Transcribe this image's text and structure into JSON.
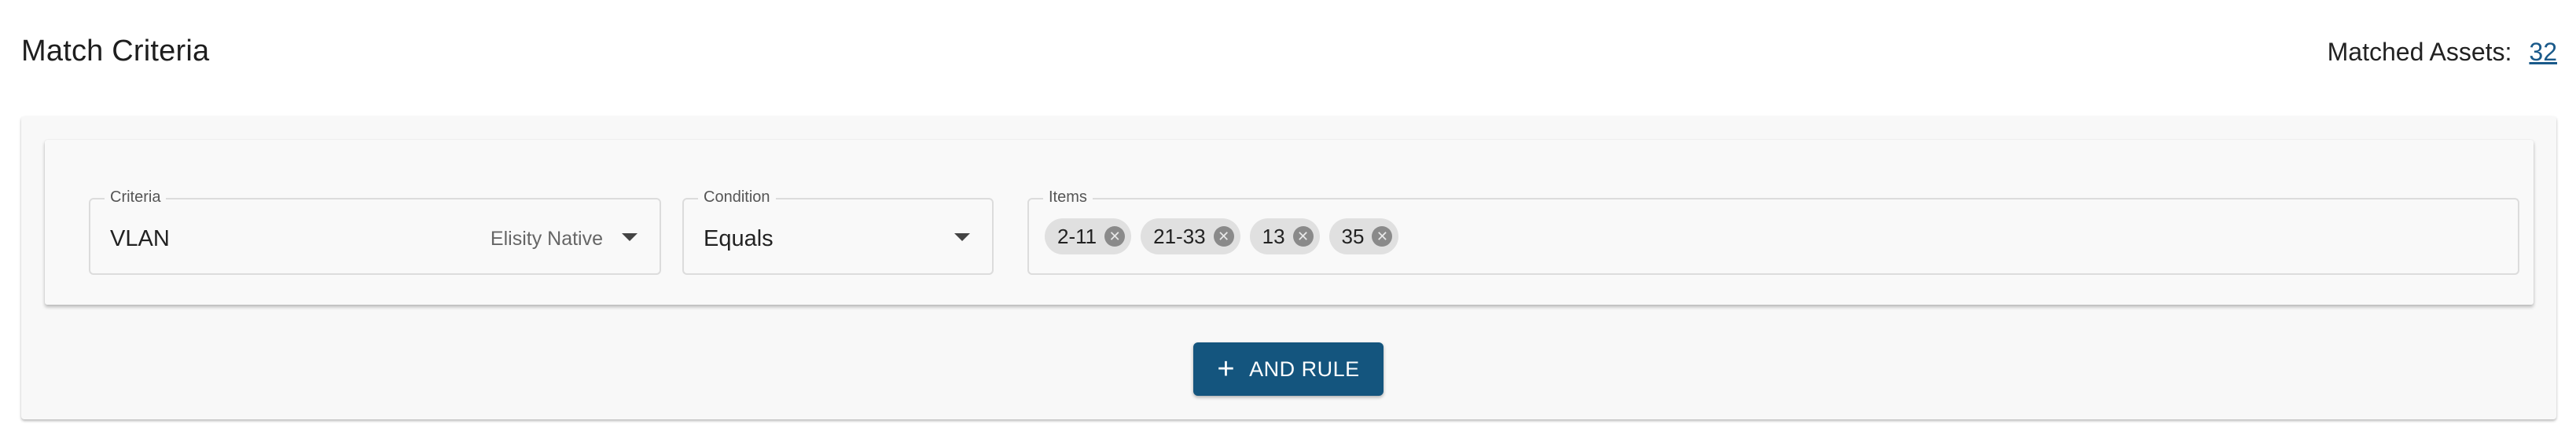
{
  "header": {
    "title": "Match Criteria",
    "matched_label": "Matched Assets:",
    "matched_count": "32"
  },
  "rule": {
    "criteria": {
      "legend": "Criteria",
      "value": "VLAN",
      "source": "Elisity Native",
      "icon": "caret-down-icon"
    },
    "condition": {
      "legend": "Condition",
      "value": "Equals",
      "icon": "caret-down-icon"
    },
    "items": {
      "legend": "Items",
      "chips": [
        "2-11",
        "21-33",
        "13",
        "35"
      ],
      "chip_remove_icon": "cancel-circle-icon"
    }
  },
  "actions": {
    "and_rule_label": "AND RULE",
    "and_rule_icon": "plus-icon"
  },
  "colors": {
    "primary_button": "#14557e",
    "link": "#1a5a8a"
  }
}
